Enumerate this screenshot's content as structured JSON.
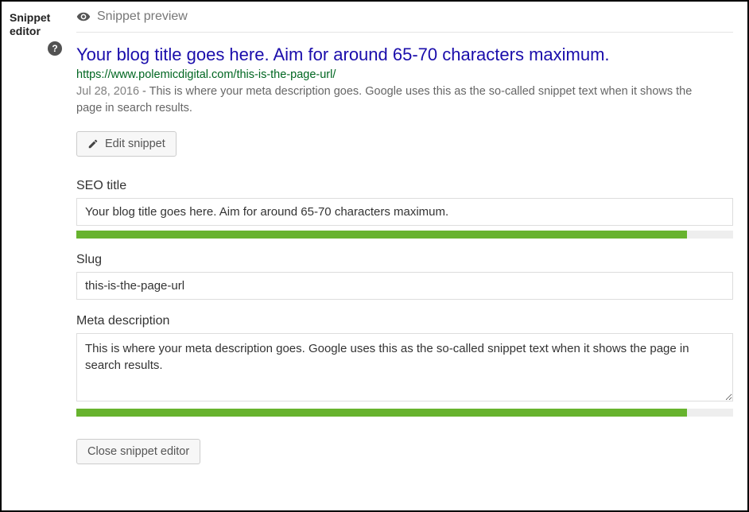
{
  "sidebar": {
    "label": "Snippet editor",
    "help_tooltip": "?"
  },
  "preview": {
    "heading": "Snippet preview",
    "title": "Your blog title goes here. Aim for around 65-70 characters maximum.",
    "url": "https://www.polemicdigital.com/this-is-the-page-url/",
    "date": "Jul 28, 2016",
    "sep": " - ",
    "description": "This is where your meta description goes. Google uses this as the so-called snippet text when it shows the page in search results.",
    "edit_button": "Edit snippet"
  },
  "form": {
    "seo_title": {
      "label": "SEO title",
      "value": "Your blog title goes here. Aim for around 65-70 characters maximum.",
      "progress_pct": 93
    },
    "slug": {
      "label": "Slug",
      "value": "this-is-the-page-url"
    },
    "meta_desc": {
      "label": "Meta description",
      "value": "This is where your meta description goes. Google uses this as the so-called snippet text when it shows the page in search results.",
      "progress_pct": 93
    },
    "close_button": "Close snippet editor"
  }
}
